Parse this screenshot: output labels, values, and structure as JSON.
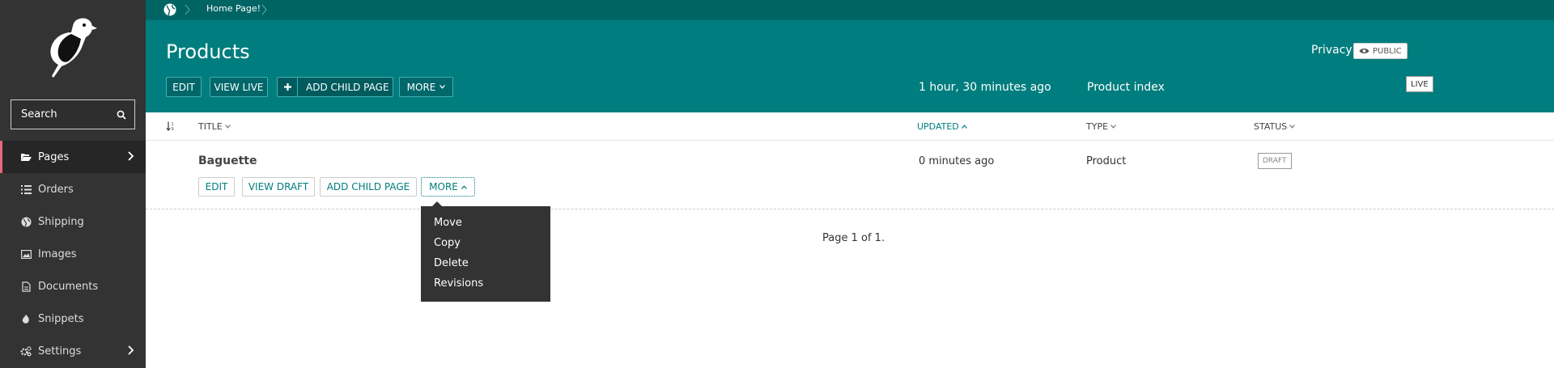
{
  "sidebar": {
    "search_placeholder": "Search",
    "items": [
      {
        "label": "Pages",
        "icon": "folder-open-icon"
      },
      {
        "label": "Orders",
        "icon": "list-icon"
      },
      {
        "label": "Shipping",
        "icon": "globe-icon"
      },
      {
        "label": "Images",
        "icon": "image-icon"
      },
      {
        "label": "Documents",
        "icon": "document-icon"
      },
      {
        "label": "Snippets",
        "icon": "snippet-icon"
      },
      {
        "label": "Settings",
        "icon": "cogs-icon"
      }
    ]
  },
  "breadcrumb": {
    "current": "Home Page!"
  },
  "header": {
    "title": "Products",
    "privacy_label": "Privacy",
    "privacy_badge": "PUBLIC",
    "buttons": {
      "edit": "EDIT",
      "view_live": "VIEW LIVE",
      "add_child": "ADD CHILD PAGE",
      "more": "MORE"
    },
    "updated": "1 hour, 30 minutes ago",
    "type": "Product index",
    "status": "LIVE"
  },
  "table": {
    "columns": {
      "title": "TITLE",
      "updated": "UPDATED",
      "type": "TYPE",
      "status": "STATUS"
    },
    "rows": [
      {
        "title": "Baguette",
        "updated": "0 minutes ago",
        "type": "Product",
        "status": "DRAFT",
        "actions": {
          "edit": "EDIT",
          "view_draft": "VIEW DRAFT",
          "add_child": "ADD CHILD PAGE",
          "more": "MORE"
        }
      }
    ]
  },
  "more_menu": {
    "items": [
      "Move",
      "Copy",
      "Delete",
      "Revisions"
    ]
  },
  "pagination": "Page 1 of 1.",
  "colors": {
    "teal": "#007d7e",
    "dark_teal": "#006465",
    "sidebar": "#333333",
    "active_accent": "#e9677d"
  }
}
